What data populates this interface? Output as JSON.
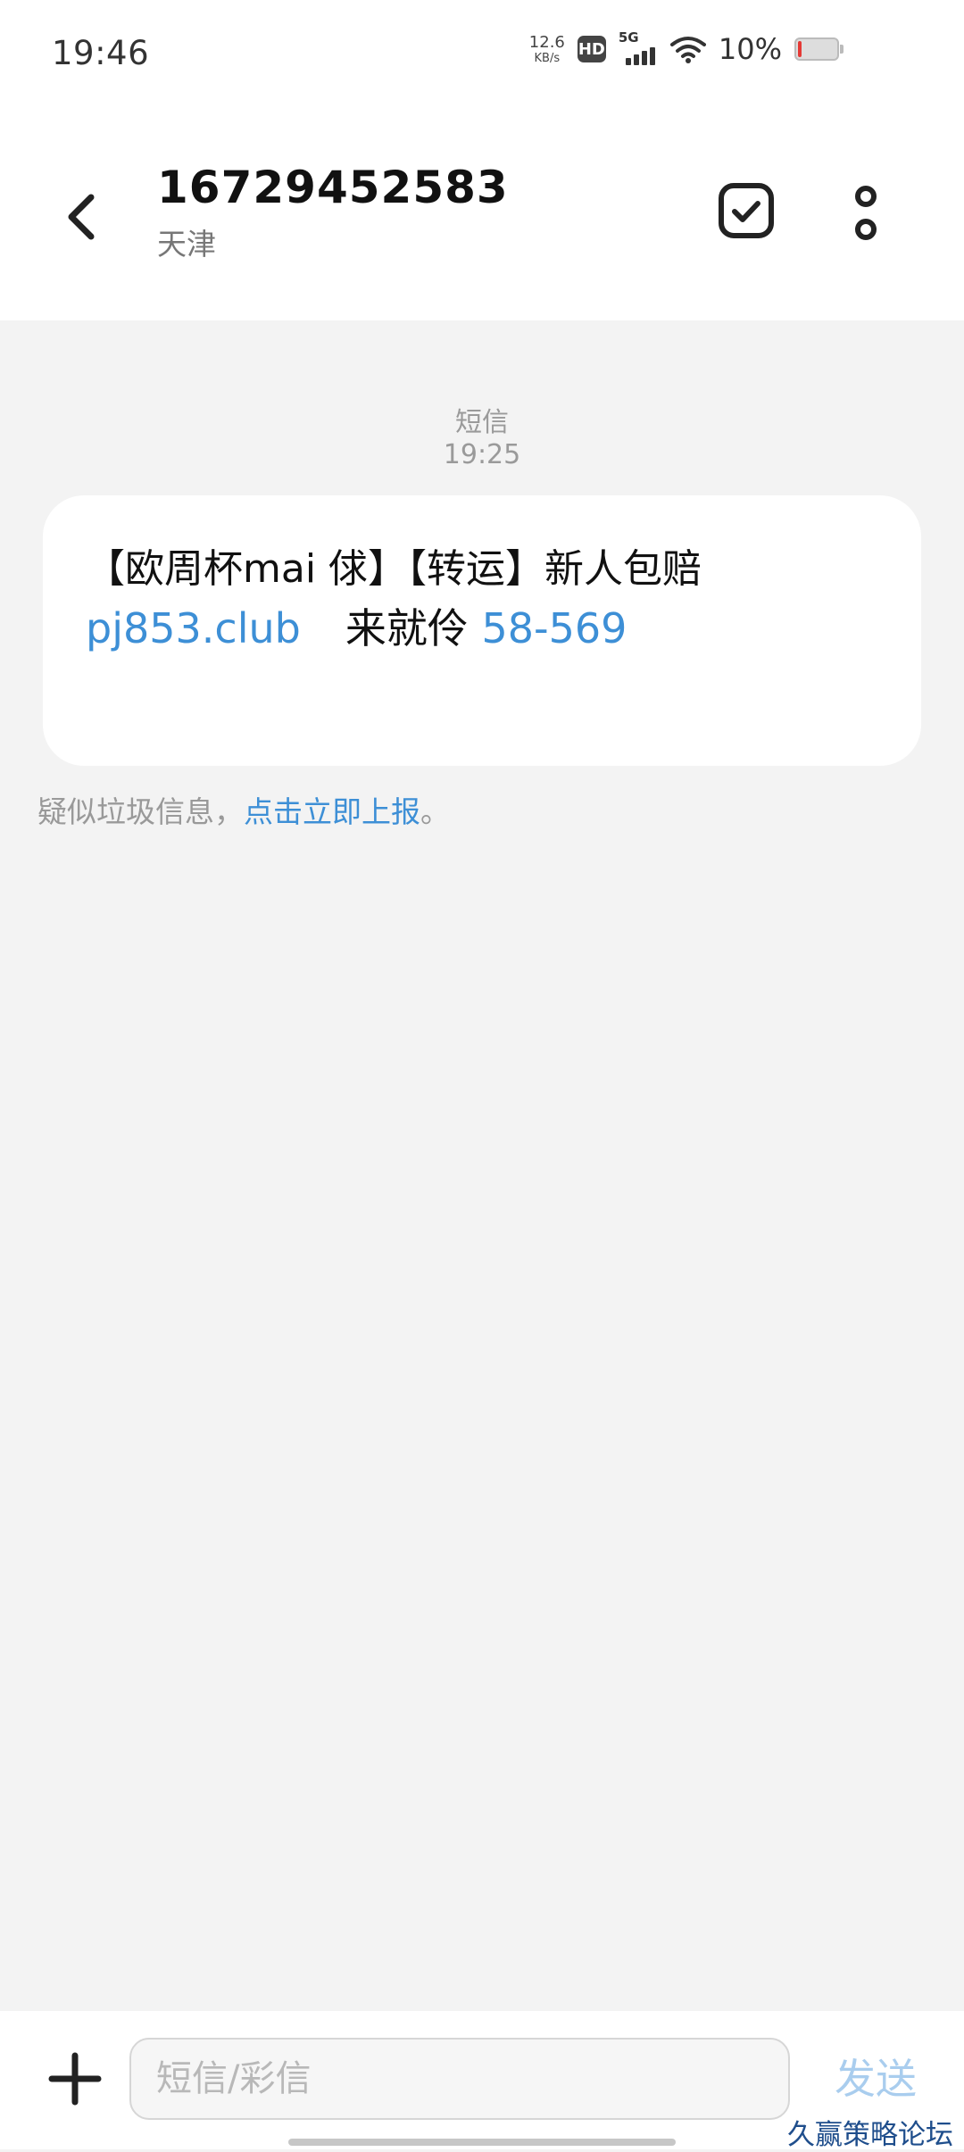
{
  "status_bar": {
    "time": "19:46",
    "net_speed_value": "12.6",
    "net_speed_unit": "KB/s",
    "hd_label": "HD",
    "network_label": "5G",
    "battery_text": "10%",
    "battery_level": 0.1
  },
  "header": {
    "contact_number": "16729452583",
    "location": "天津"
  },
  "conversation": {
    "message_type": "短信",
    "message_time": "19:25",
    "message": {
      "line1": "【欧周杯mai 俅】【转运】新人包赔",
      "link_url": "pj853.club",
      "middle_text": "来就伶",
      "link_code": "58-569"
    },
    "spam_notice": {
      "prefix": "疑似垃圾信息，",
      "link": "点击立即上报",
      "suffix": "。"
    }
  },
  "composer": {
    "placeholder": "短信/彩信",
    "send_label": "发送"
  },
  "watermark": "久赢策略论坛",
  "colors": {
    "link": "#3d8fd6",
    "send_disabled": "#a9cdee",
    "background": "#f3f3f3"
  }
}
